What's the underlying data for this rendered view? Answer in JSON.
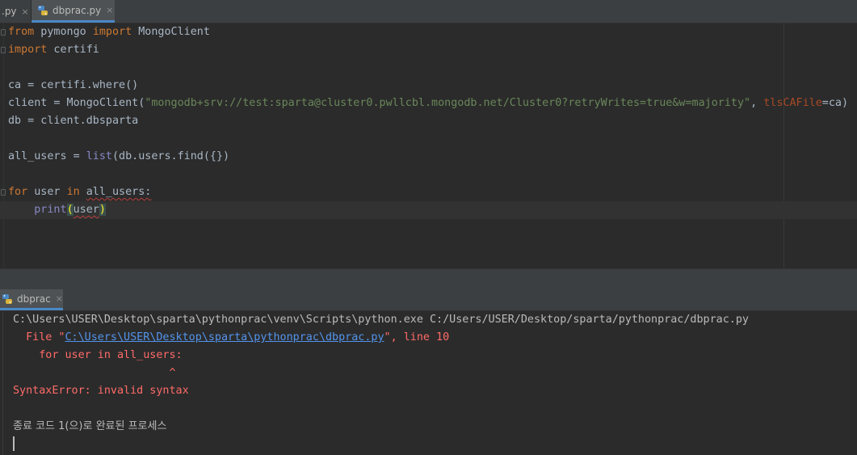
{
  "tabs": {
    "prev_tab_label": ".py",
    "active_tab_label": "dbprac.py",
    "close_glyph": "×"
  },
  "code": {
    "line1_kw1": "from",
    "line1_mod": " pymongo ",
    "line1_kw2": "import",
    "line1_name": " MongoClient",
    "line2_kw": "import",
    "line2_mod": " certifi",
    "line4": "ca = certifi.where()",
    "line5_pre": "client = MongoClient(",
    "line5_str": "\"mongodb+srv://test:sparta@cluster0.pwllcbl.mongodb.net/Cluster0?retryWrites=true&w=majority\"",
    "line5_comma": ", ",
    "line5_param": "tlsCAFile",
    "line5_post": "=ca)",
    "line6": "db = client.dbsparta",
    "line8_pre": "all_users = ",
    "line8_builtin": "list",
    "line8_post": "(db.users.find({})",
    "line10_kw1": "for",
    "line10_mid": " user ",
    "line10_kw2": "in",
    "line10_sp": " ",
    "line10_err": "all_users:",
    "line11_indent": "    ",
    "line11_builtin": "print",
    "line11_open": "(",
    "line11_arg": "user",
    "line11_close": ")"
  },
  "run_panel": {
    "tab_label": "dbprac",
    "close_glyph": "×"
  },
  "console": {
    "cmd_line": "C:\\Users\\USER\\Desktop\\sparta\\pythonprac\\venv\\Scripts\\python.exe C:/Users/USER/Desktop/sparta/pythonprac/dbprac.py",
    "file_pre": "  File \"",
    "file_link": "C:\\Users\\USER\\Desktop\\sparta\\pythonprac\\dbprac.py",
    "file_post": "\", line 10",
    "src_line": "    for user in all_users:",
    "caret_line": "                        ^",
    "error_line": "SyntaxError: invalid syntax",
    "exit_line": "종료 코드 1(으)로 완료된 프로세스"
  },
  "colors": {
    "keyword": "#cc7832",
    "string": "#6a8759",
    "error_text": "#ff6b68",
    "link": "#5394ec",
    "accent": "#4a88c7"
  },
  "icons": {
    "file_icon": "python-file-icon",
    "run_icon": "python-run-icon"
  }
}
